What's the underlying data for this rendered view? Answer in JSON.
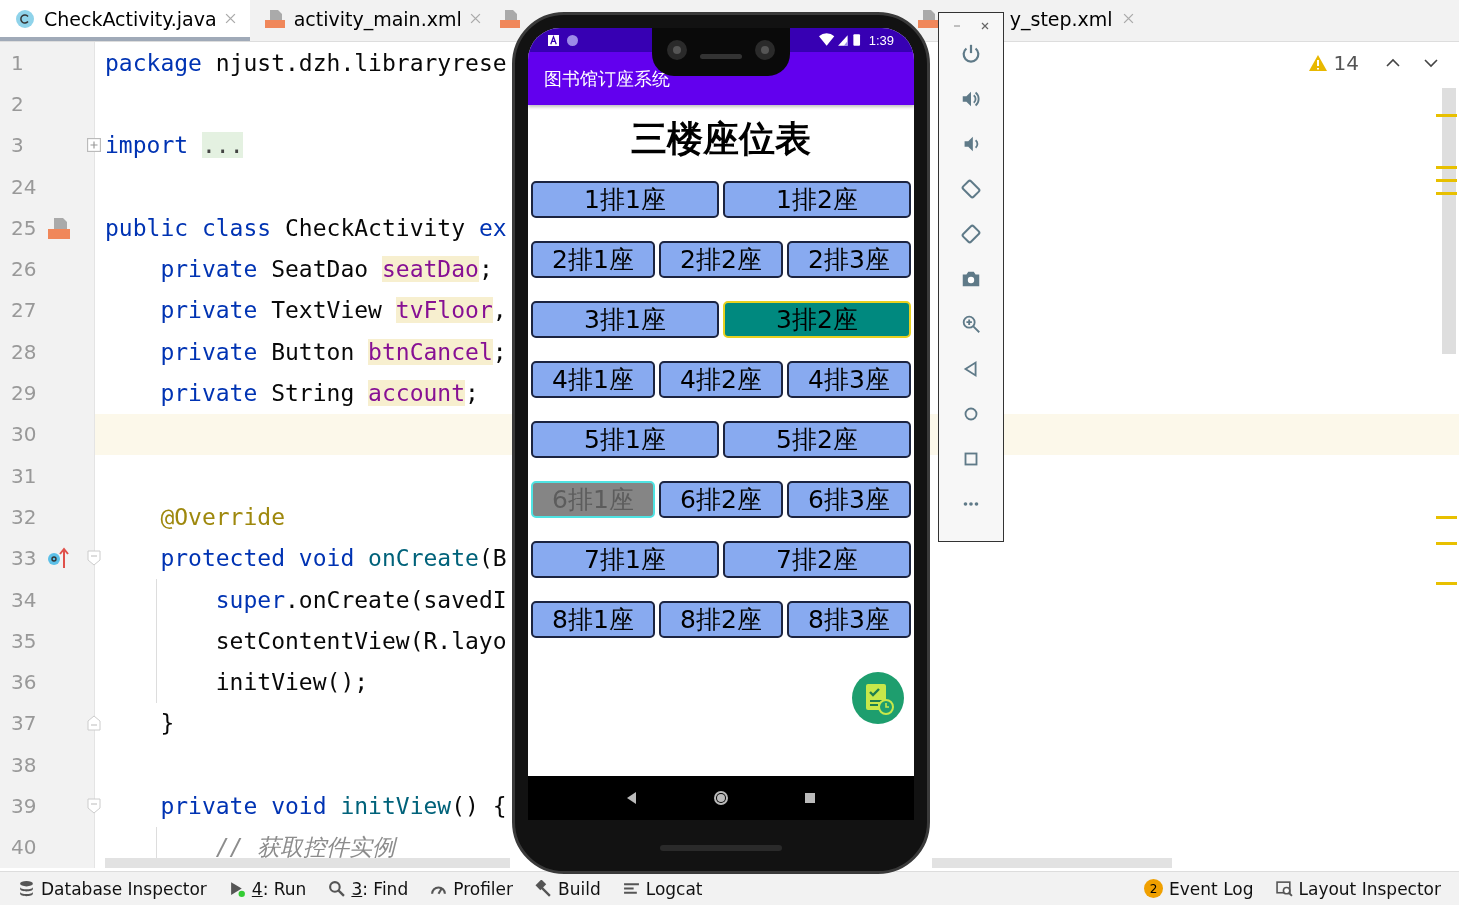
{
  "tabs": [
    {
      "label": "CheckActivity.java",
      "selected": true
    },
    {
      "label": "activity_main.xml",
      "selected": false
    },
    {
      "selected": false
    },
    {
      "label": "y_step.xml",
      "selected": false
    }
  ],
  "inspection": {
    "warnings": "14"
  },
  "code_lines": [
    {
      "number": "1",
      "kind": "plain",
      "tokens": [
        {
          "kind": "keyword",
          "text": "package"
        },
        {
          "kind": "plain",
          "text": " njust.dzh.libraryrese"
        }
      ]
    },
    {
      "number": "2",
      "kind": "plain"
    },
    {
      "number": "3",
      "kind": "folded",
      "tokens": [
        {
          "kind": "keyword",
          "text": "import "
        },
        {
          "kind": "folded",
          "text": "..."
        }
      ]
    },
    {
      "number": "24",
      "kind": "plain"
    },
    {
      "number": "25",
      "kind": "plain",
      "tokens": [
        {
          "kind": "keyword",
          "text": "public class"
        },
        {
          "kind": "plain",
          "text": " CheckActivity "
        },
        {
          "kind": "keyword",
          "text": "ex"
        }
      ]
    },
    {
      "number": "26",
      "kind": "plain",
      "tokens": [
        {
          "kind": "keyword",
          "text": "    private"
        },
        {
          "kind": "plain",
          "text": " SeatDao "
        },
        {
          "kind": "field",
          "text": "seatDao"
        },
        {
          "kind": "plain",
          "text": ";"
        }
      ]
    },
    {
      "number": "27",
      "kind": "plain",
      "tokens": [
        {
          "kind": "keyword",
          "text": "    private"
        },
        {
          "kind": "plain",
          "text": " TextView "
        },
        {
          "kind": "field",
          "text": "tvFloor"
        },
        {
          "kind": "plain",
          "text": ","
        }
      ]
    },
    {
      "number": "28",
      "kind": "plain",
      "tokens": [
        {
          "kind": "keyword",
          "text": "    private"
        },
        {
          "kind": "plain",
          "text": " Button "
        },
        {
          "kind": "field",
          "text": "btnCancel"
        },
        {
          "kind": "plain",
          "text": ";"
        }
      ]
    },
    {
      "number": "29",
      "kind": "plain",
      "tokens": [
        {
          "kind": "keyword",
          "text": "    private"
        },
        {
          "kind": "plain",
          "text": " String "
        },
        {
          "kind": "field",
          "text": "account"
        },
        {
          "kind": "plain",
          "text": ";"
        }
      ]
    },
    {
      "number": "30",
      "kind": "plain",
      "current": true
    },
    {
      "number": "31",
      "kind": "plain"
    },
    {
      "number": "32",
      "kind": "plain",
      "tokens": [
        {
          "kind": "annotation",
          "text": "    @Override"
        }
      ]
    },
    {
      "number": "33",
      "kind": "fold_start",
      "tokens": [
        {
          "kind": "keyword",
          "text": "    protected void "
        },
        {
          "kind": "method",
          "text": "onCreate"
        },
        {
          "kind": "plain",
          "text": "(B"
        }
      ]
    },
    {
      "number": "34",
      "kind": "plain",
      "guide": true,
      "tokens": [
        {
          "kind": "keyword",
          "text": "        super"
        },
        {
          "kind": "plain",
          "text": ".onCreate(savedI"
        }
      ]
    },
    {
      "number": "35",
      "kind": "plain",
      "guide": true,
      "tokens": [
        {
          "kind": "plain",
          "text": "        setContentView(R.layo"
        }
      ]
    },
    {
      "number": "36",
      "kind": "plain",
      "guide": true,
      "tokens": [
        {
          "kind": "plain",
          "text": "        initView();"
        }
      ]
    },
    {
      "number": "37",
      "kind": "fold_end",
      "tokens": [
        {
          "kind": "plain",
          "text": "    }"
        }
      ]
    },
    {
      "number": "38",
      "kind": "plain"
    },
    {
      "number": "39",
      "kind": "fold_start",
      "tokens": [
        {
          "kind": "keyword",
          "text": "    private void "
        },
        {
          "kind": "method",
          "text": "initView"
        },
        {
          "kind": "plain",
          "text": "() {"
        }
      ]
    },
    {
      "number": "40",
      "kind": "plain",
      "guide": true,
      "tokens": [
        {
          "kind": "comment",
          "text": "        // 获取控件实例"
        }
      ]
    }
  ],
  "phone": {
    "status_time": "1:39",
    "app_title": "图书馆订座系统",
    "heading": "三楼座位表",
    "seat_rows": [
      [
        {
          "label": "1排1座",
          "selected": false,
          "disabled": false
        },
        {
          "label": "1排2座",
          "selected": false,
          "disabled": false
        }
      ],
      [
        {
          "label": "2排1座",
          "selected": false,
          "disabled": false
        },
        {
          "label": "2排2座",
          "selected": false,
          "disabled": false
        },
        {
          "label": "2排3座",
          "selected": false,
          "disabled": false
        }
      ],
      [
        {
          "label": "3排1座",
          "selected": false,
          "disabled": false
        },
        {
          "label": "3排2座",
          "selected": true,
          "disabled": false
        }
      ],
      [
        {
          "label": "4排1座",
          "selected": false,
          "disabled": false
        },
        {
          "label": "4排2座",
          "selected": false,
          "disabled": false
        },
        {
          "label": "4排3座",
          "selected": false,
          "disabled": false
        }
      ],
      [
        {
          "label": "5排1座",
          "selected": false,
          "disabled": false
        },
        {
          "label": "5排2座",
          "selected": false,
          "disabled": false
        }
      ],
      [
        {
          "label": "6排1座",
          "selected": false,
          "disabled": true
        },
        {
          "label": "6排2座",
          "selected": false,
          "disabled": false
        },
        {
          "label": "6排3座",
          "selected": false,
          "disabled": false
        }
      ],
      [
        {
          "label": "7排1座",
          "selected": false,
          "disabled": false
        },
        {
          "label": "7排2座",
          "selected": false,
          "disabled": false
        }
      ],
      [
        {
          "label": "8排1座",
          "selected": false,
          "disabled": false
        },
        {
          "label": "8排2座",
          "selected": false,
          "disabled": false
        },
        {
          "label": "8排3座",
          "selected": false,
          "disabled": false
        }
      ]
    ]
  },
  "tool_windows": [
    {
      "label": "Database Inspector"
    },
    {
      "mnemonic": "4",
      "label": ": Run"
    },
    {
      "mnemonic": "3",
      "label": ": Find"
    },
    {
      "label": "Profiler"
    },
    {
      "label": "Build"
    },
    {
      "label": "Logcat"
    }
  ],
  "tool_windows_right": [
    {
      "label": "Event Log",
      "badge": "2"
    },
    {
      "label": "Layout Inspector"
    }
  ]
}
